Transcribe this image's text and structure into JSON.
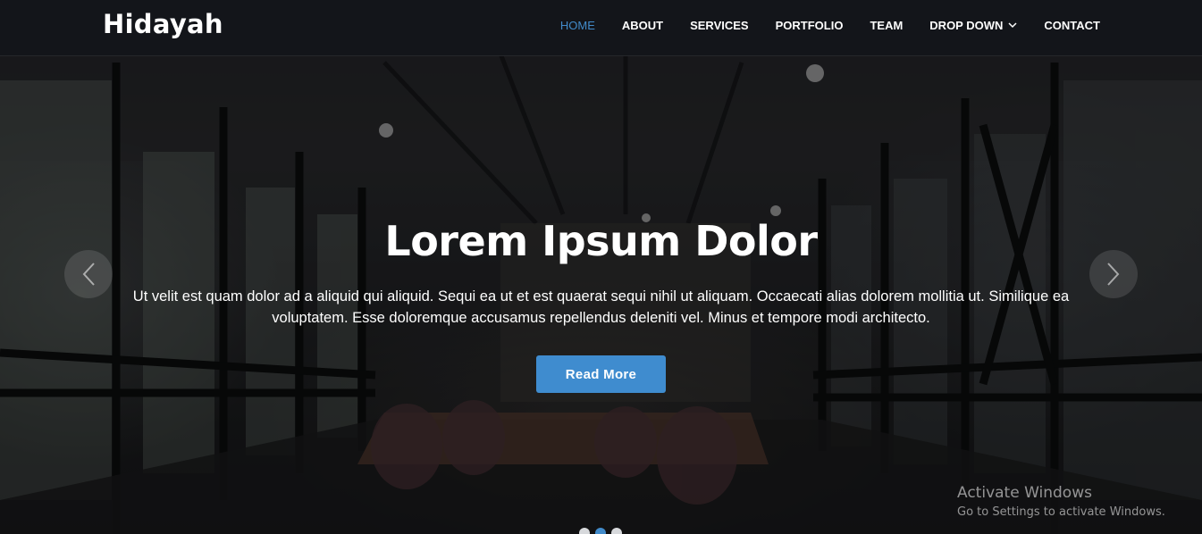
{
  "brand": {
    "logo_text": "Hidayah"
  },
  "nav": {
    "items": [
      {
        "label": "HOME",
        "active": true
      },
      {
        "label": "ABOUT",
        "active": false
      },
      {
        "label": "SERVICES",
        "active": false
      },
      {
        "label": "PORTFOLIO",
        "active": false
      },
      {
        "label": "TEAM",
        "active": false
      },
      {
        "label": "DROP DOWN",
        "active": false,
        "icon": "chevron-down-icon"
      },
      {
        "label": "CONTACT",
        "active": false
      }
    ]
  },
  "hero": {
    "title": "Lorem Ipsum Dolor",
    "text": "Ut velit est quam dolor ad a aliquid qui aliquid. Sequi ea ut et est quaerat sequi nihil ut aliquam. Occaecati alias dolorem mollitia ut. Similique ea voluptatem. Esse doloremque accusamus repellendus deleniti vel. Minus et tempore modi architecto.",
    "button_label": "Read More",
    "prev_icon": "chevron-left-icon",
    "next_icon": "chevron-right-icon",
    "slide_count": 3,
    "active_slide": 2
  },
  "watermark": {
    "title": "Activate Windows",
    "subtitle": "Go to Settings to activate Windows."
  },
  "colors": {
    "accent": "#428bca",
    "header_bg": "#14161a",
    "button_bg": "#3f8ccf",
    "text": "#ffffff"
  }
}
